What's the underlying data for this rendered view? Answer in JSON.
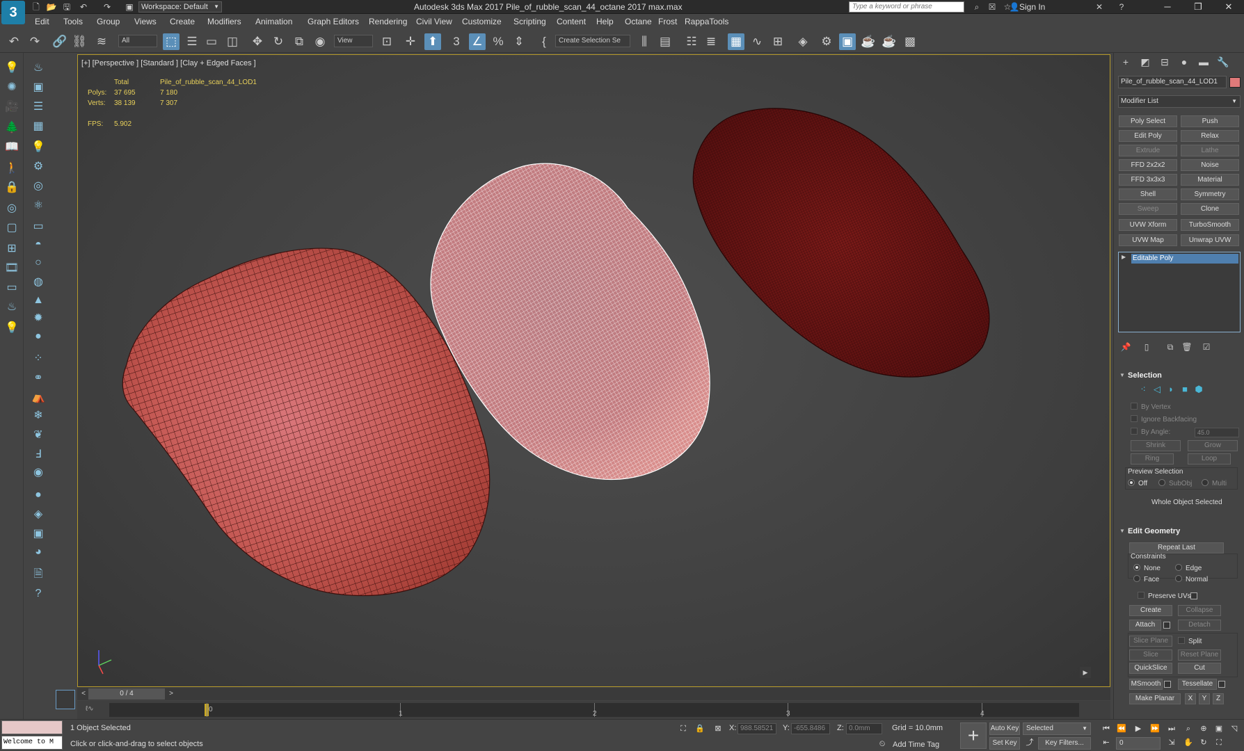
{
  "titlebar": {
    "app_logo": "3",
    "workspace": "Workspace: Default",
    "title": "Autodesk 3ds Max 2017    Pile_of_rubble_scan_44_octane 2017 max.max",
    "search_placeholder": "Type a keyword or phrase",
    "sign_in": "Sign In"
  },
  "menu": [
    "Edit",
    "Tools",
    "Group",
    "Views",
    "Create",
    "Modifiers",
    "Animation",
    "Graph Editors",
    "Rendering",
    "Civil View",
    "Customize",
    "Scripting",
    "Content",
    "Help",
    "Octane",
    "Frost",
    "RappaTools"
  ],
  "toolbar": {
    "filter": "All",
    "coord_system": "View",
    "selection_set": "Create Selection Se"
  },
  "viewport": {
    "label": "[+] [Perspective ] [Standard ] [Clay + Edged Faces ]",
    "stats": {
      "total_label": "Total",
      "object_name": "Pile_of_rubble_scan_44_LOD1",
      "polys_label": "Polys:",
      "polys_total": "37 695",
      "polys_object": "7 180",
      "verts_label": "Verts:",
      "verts_total": "38 139",
      "verts_object": "7 307",
      "fps_label": "FPS:",
      "fps_value": "5.902"
    }
  },
  "timeslider": {
    "frame": "0 / 4",
    "ticks": [
      "0",
      "1",
      "2",
      "3",
      "4"
    ]
  },
  "statusbar": {
    "listener_text": "Welcome to M",
    "selection_count": "1 Object Selected",
    "prompt": "Click or click-and-drag to select objects",
    "x_label": "X:",
    "x_value": "988.58521",
    "y_label": "Y:",
    "y_value": "-655.8486",
    "z_label": "Z:",
    "z_value": "0.0mm",
    "grid": "Grid = 10.0mm",
    "add_time_tag": "Add Time Tag",
    "auto_key": "Auto Key",
    "set_key": "Set Key",
    "selected_dd": "Selected",
    "key_filters": "Key Filters...",
    "frame_field": "0"
  },
  "cmdpanel": {
    "object_name": "Pile_of_rubble_scan_44_LOD1",
    "object_color": "#e07a7a",
    "modifier_list": "Modifier List",
    "modifier_buttons": [
      {
        "label": "Poly Select",
        "enabled": true
      },
      {
        "label": "Push",
        "enabled": true
      },
      {
        "label": "Edit Poly",
        "enabled": true
      },
      {
        "label": "Relax",
        "enabled": true
      },
      {
        "label": "Extrude",
        "enabled": false
      },
      {
        "label": "Lathe",
        "enabled": false
      },
      {
        "label": "FFD 2x2x2",
        "enabled": true
      },
      {
        "label": "Noise",
        "enabled": true
      },
      {
        "label": "FFD 3x3x3",
        "enabled": true
      },
      {
        "label": "Material",
        "enabled": true
      },
      {
        "label": "Shell",
        "enabled": true
      },
      {
        "label": "Symmetry",
        "enabled": true
      },
      {
        "label": "Sweep",
        "enabled": false
      },
      {
        "label": "Clone",
        "enabled": true
      },
      {
        "label": "UVW Xform",
        "enabled": true
      },
      {
        "label": "TurboSmooth",
        "enabled": true
      },
      {
        "label": "UVW Map",
        "enabled": true
      },
      {
        "label": "Unwrap UVW",
        "enabled": true
      }
    ],
    "stack_item": "Editable Poly",
    "selection": {
      "title": "Selection",
      "by_vertex": "By Vertex",
      "ignore_backfacing": "Ignore Backfacing",
      "by_angle": "By Angle:",
      "angle_value": "45.0",
      "shrink": "Shrink",
      "grow": "Grow",
      "ring": "Ring",
      "loop": "Loop",
      "preview_selection": "Preview Selection",
      "off": "Off",
      "subobj": "SubObj",
      "multi": "Multi",
      "whole_object": "Whole Object Selected"
    },
    "edit_geometry": {
      "title": "Edit Geometry",
      "repeat_last": "Repeat Last",
      "constraints": "Constraints",
      "none": "None",
      "edge": "Edge",
      "face": "Face",
      "normal": "Normal",
      "preserve_uvs": "Preserve UVs",
      "create": "Create",
      "collapse": "Collapse",
      "attach": "Attach",
      "detach": "Detach",
      "slice_plane": "Slice Plane",
      "split": "Split",
      "slice": "Slice",
      "reset_plane": "Reset Plane",
      "quickslice": "QuickSlice",
      "cut": "Cut",
      "msmooth": "MSmooth",
      "tessellate": "Tessellate",
      "make_planar": "Make Planar",
      "x": "X",
      "y": "Y",
      "z": "Z"
    }
  }
}
